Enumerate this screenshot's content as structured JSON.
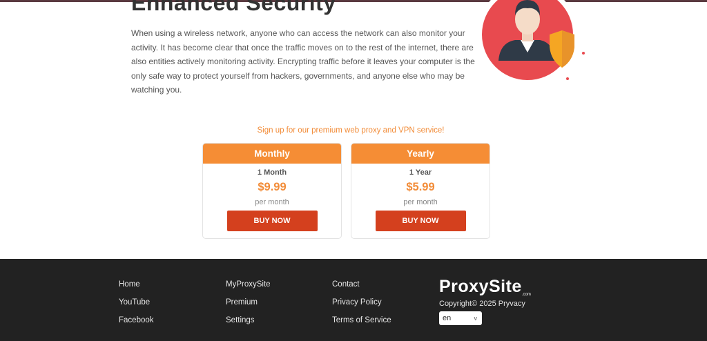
{
  "section": {
    "title": "Enhanced Security",
    "description": "When using a wireless network, anyone who can access the network can also monitor your activity. It has become clear that once the traffic moves on to the rest of the internet, there are also entities actively monitoring activity. Encrypting traffic before it leaves your computer is the only safe way to protect yourself from hackers, governments, and anyone else who may be watching you."
  },
  "signup_text": "Sign up for our premium web proxy and VPN service!",
  "plans": [
    {
      "name": "Monthly",
      "duration": "1 Month",
      "price": "$9.99",
      "period": "per month",
      "button": "BUY NOW"
    },
    {
      "name": "Yearly",
      "duration": "1 Year",
      "price": "$5.99",
      "period": "per month",
      "button": "BUY NOW"
    }
  ],
  "footer": {
    "col1": [
      "Home",
      "YouTube",
      "Facebook"
    ],
    "col2": [
      "MyProxySite",
      "Premium",
      "Settings"
    ],
    "col3": [
      "Contact",
      "Privacy Policy",
      "Terms of Service"
    ],
    "logo": "ProxySite",
    "logo_suffix": ".com",
    "copyright": "Copyright© 2025 Pryvacy",
    "language": "en"
  },
  "colors": {
    "accent": "#f58d35",
    "button": "#d4401e",
    "footer_bg": "#222222",
    "illustration_red": "#e84a4f"
  }
}
